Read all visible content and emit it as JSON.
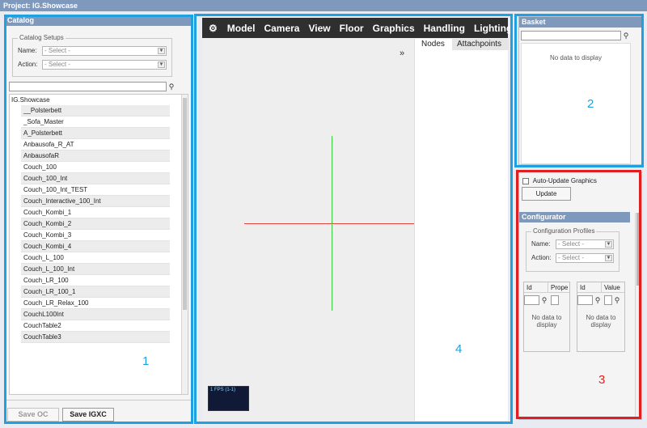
{
  "window": {
    "title": "Project: IG.Showcase"
  },
  "catalog": {
    "header": "Catalog",
    "setups_legend": "Catalog Setups",
    "name_label": "Name:",
    "action_label": "Action:",
    "name_value": "- Select -",
    "action_value": "- Select -",
    "root": "IG.Showcase",
    "items": [
      "__Polsterbett",
      "_Sofa_Master",
      "A_Polsterbett",
      "Anbausofa_R_AT",
      "AnbausofaR",
      "Couch_100",
      "Couch_100_Int",
      "Couch_100_Int_TEST",
      "Couch_Interactive_100_Int",
      "Couch_Kombi_1",
      "Couch_Kombi_2",
      "Couch_Kombi_3",
      "Couch_Kombi_4",
      "Couch_L_100",
      "Couch_L_100_Int",
      "Couch_LR_100",
      "Couch_LR_100_1",
      "Couch_LR_Relax_100",
      "CouchL100Int",
      "CouchTable2",
      "CouchTable3"
    ],
    "save_oc": "Save OC",
    "save_igxc": "Save IGXC"
  },
  "viewer": {
    "menu": [
      "Model",
      "Camera",
      "View",
      "Floor",
      "Graphics",
      "Handling",
      "Lighting"
    ],
    "collapse": "»",
    "tabs": [
      "Nodes",
      "Attachpoints"
    ],
    "fps": "1 FPS (1-1)"
  },
  "basket": {
    "header": "Basket",
    "empty": "No data to display"
  },
  "configurator": {
    "auto_update": "Auto-Update Graphics",
    "update_button": "Update",
    "header": "Configurator",
    "profiles_legend": "Configuration Profiles",
    "name_label": "Name:",
    "action_label": "Action:",
    "name_value": "- Select -",
    "action_value": "- Select -",
    "left_cols": [
      "Id",
      "Prope"
    ],
    "right_cols": [
      "Id",
      "Value"
    ],
    "empty": "No data to display"
  },
  "annotations": {
    "n1": "1",
    "n2": "2",
    "n3": "3",
    "n4": "4"
  },
  "colors": {
    "highlight_blue": "#1fa0e0",
    "highlight_red": "#e02020",
    "header": "#7f99bd",
    "toolbar": "#2f2f2f"
  }
}
